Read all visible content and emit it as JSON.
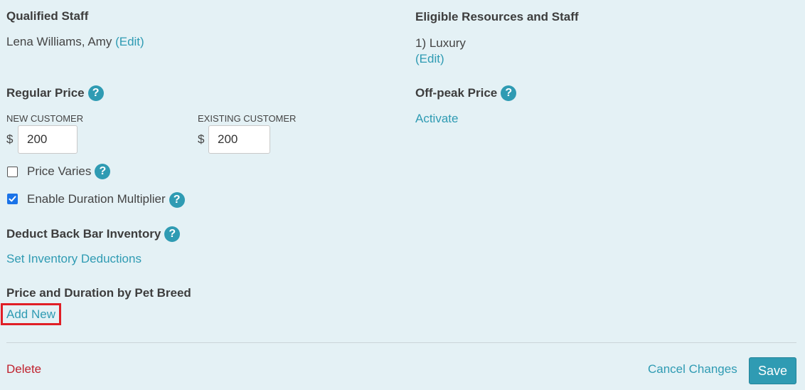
{
  "qualified_staff": {
    "heading": "Qualified Staff",
    "value": "Lena Williams, Amy",
    "edit_label": "(Edit)"
  },
  "eligible_resources": {
    "heading": "Eligible Resources and Staff",
    "value": "1) Luxury",
    "edit_label": "(Edit)"
  },
  "regular_price": {
    "heading": "Regular Price",
    "new_customer_label": "NEW CUSTOMER",
    "existing_customer_label": "EXISTING CUSTOMER",
    "currency_symbol": "$",
    "new_customer_value": "200",
    "existing_customer_value": "200"
  },
  "off_peak_price": {
    "heading": "Off-peak Price",
    "activate_label": "Activate"
  },
  "options": {
    "price_varies_label": "Price Varies",
    "price_varies_checked": false,
    "duration_multiplier_label": "Enable Duration Multiplier",
    "duration_multiplier_checked": true
  },
  "back_bar_inventory": {
    "heading": "Deduct Back Bar Inventory",
    "link_label": "Set Inventory Deductions"
  },
  "pet_breed": {
    "heading": "Price and Duration by Pet Breed",
    "add_new_label": "Add New"
  },
  "footer": {
    "delete_label": "Delete",
    "cancel_label": "Cancel Changes",
    "save_label": "Save"
  },
  "help_icon_glyph": "?",
  "colors": {
    "background": "#e4f1f5",
    "link": "#2f9bb3",
    "delete": "#c0222e",
    "highlight": "#e01f26"
  }
}
